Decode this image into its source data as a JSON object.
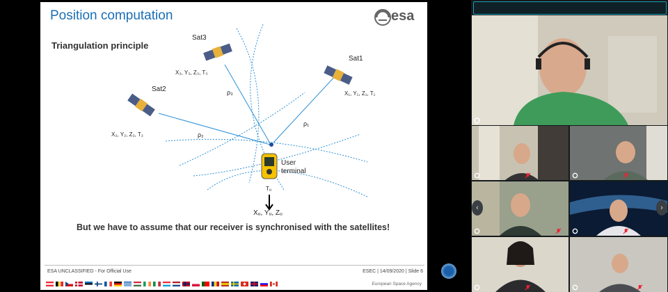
{
  "slide": {
    "title": "Position computation",
    "logo": "esa",
    "subtitle": "Triangulation principle",
    "satellites": [
      {
        "name": "Sat1",
        "coords": "X₁, Y₁, Z₁, T₁",
        "range": "ρ₁"
      },
      {
        "name": "Sat2",
        "coords": "X₂, Y₂, Z₂, T₂",
        "range": "ρ₂"
      },
      {
        "name": "Sat3",
        "coords": "X₃, Y₃, Z₃, T₃",
        "range": "ρ₃"
      }
    ],
    "user_terminal": {
      "line1": "User",
      "line2": "terminal",
      "time": "Tᵤ",
      "position": "Xᵤ, Yᵤ, Zᵤ"
    },
    "conclusion": "But we have to assume that our receiver is synchronised with the satellites!",
    "footer_left": "ESA UNCLASSIFIED - For Official Use",
    "footer_right": "ESEC | 14/09/2020 | Slide  6",
    "agency": "European Space Agency"
  },
  "colors": {
    "title_blue": "#1a6eb5",
    "ray_blue": "#2a8fd6",
    "call_accent": "#1aa0b5"
  },
  "icons": {
    "presenter_badge": "presenter-icon",
    "mic_off": "mic-muted-icon",
    "nav_left": "chevron-left-icon",
    "nav_right": "chevron-right-icon"
  }
}
